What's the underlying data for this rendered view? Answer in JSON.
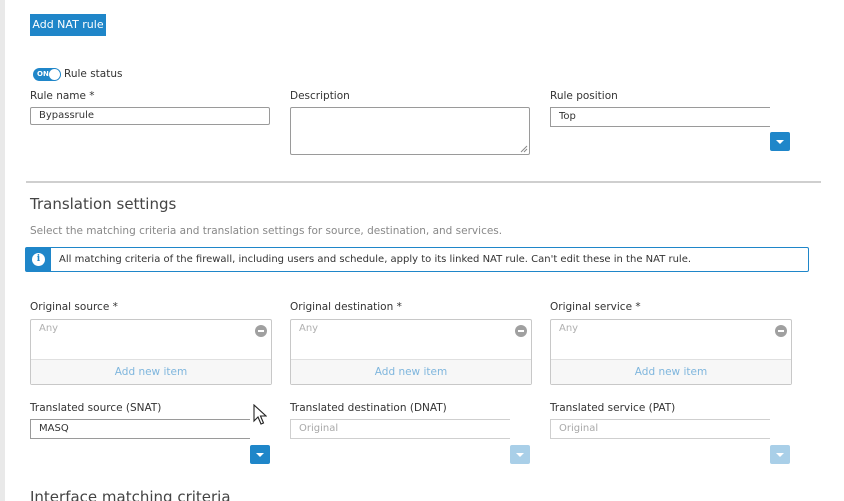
{
  "toolbar": {
    "add_nat_rule_label": "Add NAT rule"
  },
  "rule_status": {
    "toggle_text": "ON",
    "label": "Rule status"
  },
  "rule_name": {
    "label": "Rule name *",
    "value": "Bypassrule"
  },
  "description": {
    "label": "Description",
    "value": ""
  },
  "rule_position": {
    "label": "Rule position",
    "value": "Top"
  },
  "translation": {
    "title": "Translation settings",
    "subtitle": "Select the matching criteria and translation settings for source, destination, and services.",
    "info": "All matching criteria of the firewall, including users and schedule, apply to its linked NAT rule. Can't edit these in the NAT rule."
  },
  "original_source": {
    "label": "Original source *",
    "item": "Any",
    "add_label": "Add new item"
  },
  "original_destination": {
    "label": "Original destination *",
    "item": "Any",
    "add_label": "Add new item"
  },
  "original_service": {
    "label": "Original service *",
    "item": "Any",
    "add_label": "Add new item"
  },
  "translated_source": {
    "label": "Translated source (SNAT)",
    "value": "MASQ"
  },
  "translated_destination": {
    "label": "Translated destination (DNAT)",
    "value": "Original"
  },
  "translated_service": {
    "label": "Translated service (PAT)",
    "value": "Original"
  },
  "interface": {
    "title": "Interface matching criteria"
  },
  "colors": {
    "accent": "#1f86c9",
    "accent_disabled": "#a9cfe8",
    "divider": "#cfcfcf"
  },
  "icons": [
    "toggle-switch",
    "info-icon",
    "minus-circle-icon",
    "chevron-down-icon",
    "mouse-cursor"
  ]
}
